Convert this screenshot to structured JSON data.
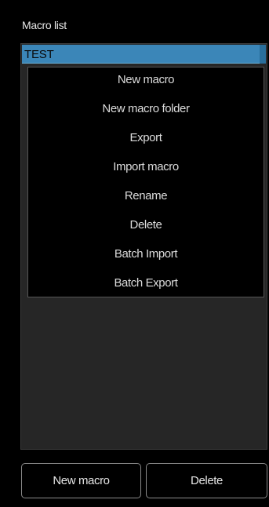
{
  "panel": {
    "title": "Macro list"
  },
  "list": {
    "items": [
      {
        "label": "TEST",
        "selected": true
      }
    ]
  },
  "context_menu": {
    "items": [
      {
        "label": "New macro"
      },
      {
        "label": "New macro folder"
      },
      {
        "label": "Export"
      },
      {
        "label": "Import macro"
      },
      {
        "label": "Rename"
      },
      {
        "label": "Delete"
      },
      {
        "label": "Batch Import"
      },
      {
        "label": "Batch Export"
      }
    ]
  },
  "buttons": {
    "new_macro_label": "New macro",
    "delete_label": "Delete"
  },
  "colors": {
    "selection": "#3b86b8",
    "background": "#000000",
    "list_background": "#262626",
    "text": "#dcdcdc"
  }
}
